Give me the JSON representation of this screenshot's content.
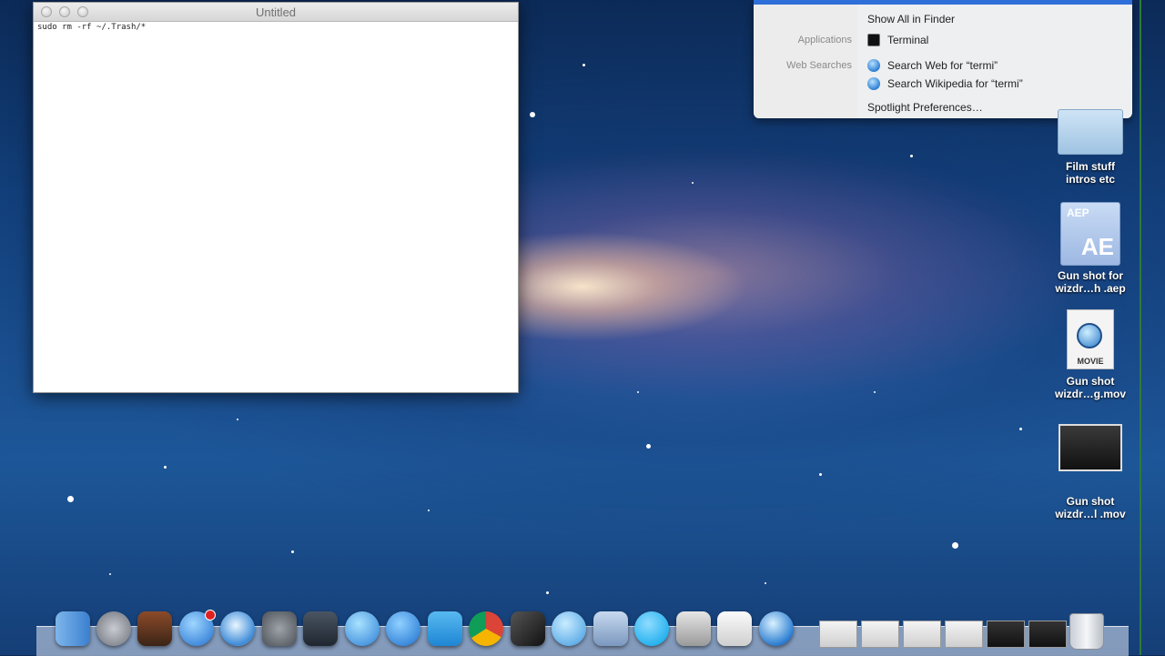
{
  "editor": {
    "title": "Untitled",
    "content": "sudo rm -rf ~/.Trash/*"
  },
  "spotlight": {
    "show_all": "Show All in Finder",
    "categories": {
      "applications": "Applications",
      "web_searches": "Web Searches"
    },
    "results": {
      "terminal": "Terminal",
      "search_web": "Search Web for “termi”",
      "search_wikipedia": "Search Wikipedia for “termi”"
    },
    "preferences": "Spotlight Preferences…",
    "accent": "#2f6fd9"
  },
  "desktop": {
    "icons": [
      {
        "label1": "Film stuff",
        "label2": "intros etc",
        "icon": "folder-icon"
      },
      {
        "label1": "Gun shot for",
        "label2": "wizdr…h .aep",
        "icon": "after-effects-file-icon",
        "tag": "AEP",
        "big": "AE"
      },
      {
        "label1": "Gun shot",
        "label2": "wizdr…g.mov",
        "icon": "quicktime-movie-icon",
        "tag": "MOVIE"
      },
      {
        "label1": "Gun shot",
        "label2": "wizdr…l .mov",
        "icon": "video-thumbnail-icon"
      }
    ]
  },
  "dock": {
    "apps": [
      "finder-icon",
      "launchpad-icon",
      "photo-booth-icon",
      "app-store-icon",
      "safari-icon",
      "system-preferences-icon",
      "screen-recorder-icon",
      "itunes-icon",
      "vlc-icon",
      "twitter-icon",
      "chrome-icon",
      "final-cut-icon",
      "messages-icon",
      "preview-icon",
      "skype-icon",
      "image-capture-icon",
      "textedit-icon",
      "quicktime-icon"
    ],
    "app_store_badge": "1"
  }
}
